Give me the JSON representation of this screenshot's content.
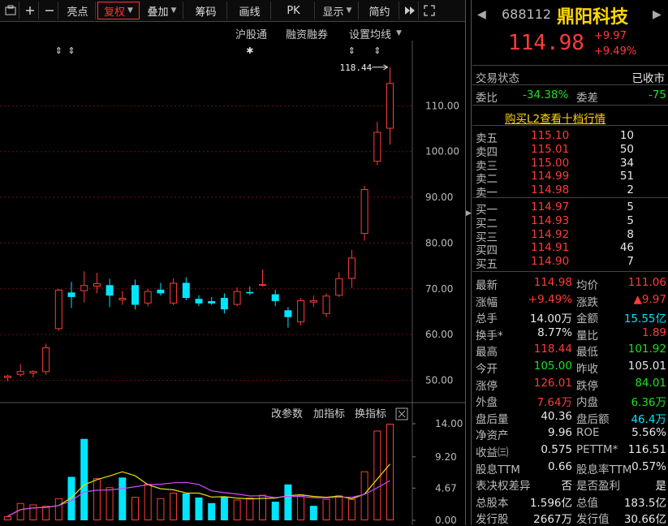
{
  "toolbar": {
    "buttons": [
      "亮点",
      "复权",
      "叠加",
      "筹码",
      "画线",
      "PK",
      "显示",
      "简约"
    ],
    "active": "复权",
    "icons": [
      "screen-icon",
      "plus-icon",
      "minus-icon",
      "fast-forward-icon",
      "expand-icon"
    ]
  },
  "chart_header": {
    "hgt": "沪股通",
    "margin": "融资融券",
    "ma_setting": "设置均线"
  },
  "volume_header": {
    "params": "改参数",
    "add": "加指标",
    "switch": "换指标"
  },
  "markers": {
    "high_label": "118.44"
  },
  "colors": {
    "up": "#ff3b3b",
    "down": "#00e5ff",
    "ma_yellow": "#e8e000",
    "ma_purple": "#d14cff",
    "grid": "#6b1010"
  },
  "chart_data": [
    {
      "type": "candlestick",
      "ylim": [
        46,
        120
      ],
      "price_ticks": [
        "110.00",
        "100.00",
        "90.00",
        "80.00",
        "70.00",
        "60.00",
        "50.00"
      ],
      "tick_values": [
        110,
        100,
        90,
        80,
        70,
        60,
        50
      ],
      "candles": [
        {
          "o": 50.5,
          "h": 51.2,
          "l": 49.8,
          "c": 51.0
        },
        {
          "o": 51.2,
          "h": 53.5,
          "l": 50.8,
          "c": 52.0
        },
        {
          "o": 51.5,
          "h": 52.2,
          "l": 50.6,
          "c": 52.0
        },
        {
          "o": 51.8,
          "h": 58.0,
          "l": 51.2,
          "c": 57.2
        },
        {
          "o": 61.2,
          "h": 70.0,
          "l": 60.8,
          "c": 69.8
        },
        {
          "o": 69.2,
          "h": 71.5,
          "l": 65.8,
          "c": 68.2
        },
        {
          "o": 69.5,
          "h": 73.8,
          "l": 67.0,
          "c": 70.8
        },
        {
          "o": 70.5,
          "h": 73.5,
          "l": 69.0,
          "c": 71.2
        },
        {
          "o": 70.8,
          "h": 72.2,
          "l": 66.0,
          "c": 68.5
        },
        {
          "o": 67.5,
          "h": 69.5,
          "l": 66.5,
          "c": 68.0
        },
        {
          "o": 70.8,
          "h": 72.0,
          "l": 65.5,
          "c": 66.5
        },
        {
          "o": 66.8,
          "h": 70.0,
          "l": 66.2,
          "c": 69.5
        },
        {
          "o": 69.8,
          "h": 71.3,
          "l": 68.5,
          "c": 69.0
        },
        {
          "o": 66.8,
          "h": 72.3,
          "l": 66.4,
          "c": 71.3
        },
        {
          "o": 71.3,
          "h": 72.5,
          "l": 67.5,
          "c": 68.0
        },
        {
          "o": 67.8,
          "h": 68.6,
          "l": 66.2,
          "c": 66.8
        },
        {
          "o": 67.3,
          "h": 68.2,
          "l": 66.5,
          "c": 66.8
        },
        {
          "o": 68.0,
          "h": 69.0,
          "l": 64.6,
          "c": 65.5
        },
        {
          "o": 66.5,
          "h": 70.3,
          "l": 66.2,
          "c": 69.5
        },
        {
          "o": 69.3,
          "h": 70.5,
          "l": 68.6,
          "c": 69.0
        },
        {
          "o": 71.0,
          "h": 74.2,
          "l": 70.5,
          "c": 71.0
        },
        {
          "o": 68.8,
          "h": 69.8,
          "l": 66.2,
          "c": 67.3
        },
        {
          "o": 65.3,
          "h": 66.0,
          "l": 61.5,
          "c": 63.8
        },
        {
          "o": 62.7,
          "h": 68.0,
          "l": 62.0,
          "c": 67.5
        },
        {
          "o": 67.0,
          "h": 68.5,
          "l": 66.0,
          "c": 67.5
        },
        {
          "o": 64.5,
          "h": 69.0,
          "l": 63.8,
          "c": 68.5
        },
        {
          "o": 68.5,
          "h": 73.6,
          "l": 68.2,
          "c": 72.3
        },
        {
          "o": 72.2,
          "h": 78.5,
          "l": 70.2,
          "c": 76.8
        },
        {
          "o": 82.0,
          "h": 92.5,
          "l": 80.5,
          "c": 91.8
        },
        {
          "o": 97.8,
          "h": 106.5,
          "l": 97.0,
          "c": 104.3
        },
        {
          "o": 105.0,
          "h": 118.44,
          "l": 101.5,
          "c": 114.98
        }
      ]
    },
    {
      "type": "bar",
      "ylim": [
        0,
        14.0
      ],
      "vol_ticks": [
        "14.00",
        "9.20",
        "4.67",
        "0.00"
      ],
      "tick_values": [
        14.0,
        9.2,
        4.67,
        0
      ],
      "volumes": [
        0.6,
        2.5,
        2.3,
        2.1,
        3.2,
        6.3,
        11.8,
        6.1,
        4.8,
        6.2,
        3.4,
        5.3,
        3.2,
        4.0,
        3.9,
        3.3,
        2.5,
        3.4,
        3.0,
        3.3,
        3.7,
        2.7,
        5.2,
        3.6,
        2.1,
        3.1,
        3.6,
        3.1,
        7.1,
        13.0,
        14.0
      ],
      "up": [
        true,
        true,
        true,
        true,
        true,
        false,
        false,
        true,
        true,
        false,
        true,
        true,
        true,
        true,
        false,
        false,
        false,
        false,
        true,
        true,
        true,
        false,
        false,
        true,
        false,
        true,
        true,
        true,
        true,
        true,
        true
      ]
    }
  ],
  "quote": {
    "code": "688112",
    "name": "鼎阳科技",
    "price": "114.98",
    "change": "+9.97",
    "change_pct": "+9.49%"
  },
  "status": {
    "label": "交易状态",
    "value": "已收市"
  },
  "weibi": {
    "label1": "委比",
    "v1": "-34.38%",
    "label2": "委差",
    "v2": "-75"
  },
  "l2_link": "购买L2查看十档行情",
  "sells": [
    {
      "label": "卖五",
      "price": "115.10",
      "vol": "10"
    },
    {
      "label": "卖四",
      "price": "115.01",
      "vol": "50"
    },
    {
      "label": "卖三",
      "price": "115.00",
      "vol": "34"
    },
    {
      "label": "卖二",
      "price": "114.99",
      "vol": "51"
    },
    {
      "label": "卖一",
      "price": "114.98",
      "vol": "2"
    }
  ],
  "buys": [
    {
      "label": "买一",
      "price": "114.97",
      "vol": "5"
    },
    {
      "label": "买二",
      "price": "114.93",
      "vol": "5"
    },
    {
      "label": "买三",
      "price": "114.92",
      "vol": "8"
    },
    {
      "label": "买四",
      "price": "114.91",
      "vol": "46"
    },
    {
      "label": "买五",
      "price": "114.90",
      "vol": "7"
    }
  ],
  "stats": [
    {
      "l1": "最新",
      "v1": "114.98",
      "c1": "red",
      "l2": "均价",
      "v2": "111.06",
      "c2": "red"
    },
    {
      "l1": "涨幅",
      "v1": "+9.49%",
      "c1": "red",
      "l2": "涨跌",
      "v2": "▲9.97",
      "c2": "red"
    },
    {
      "l1": "总手",
      "v1": "14.00万",
      "c1": "white",
      "l2": "金额",
      "v2": "15.55亿",
      "c2": "cyan"
    },
    {
      "l1": "换手*",
      "v1": "8.77%",
      "c1": "white",
      "l2": "量比",
      "v2": "1.89",
      "c2": "red"
    },
    {
      "l1": "最高",
      "v1": "118.44",
      "c1": "red",
      "l2": "最低",
      "v2": "101.92",
      "c2": "green"
    },
    {
      "l1": "今开",
      "v1": "105.00",
      "c1": "green",
      "l2": "昨收",
      "v2": "105.01",
      "c2": "white"
    },
    {
      "l1": "涨停",
      "v1": "126.01",
      "c1": "red",
      "l2": "跌停",
      "v2": "84.01",
      "c2": "green"
    },
    {
      "l1": "外盘",
      "v1": "7.64万",
      "c1": "red",
      "l2": "内盘",
      "v2": "6.36万",
      "c2": "green"
    },
    {
      "l1": "盘后量",
      "v1": "40.36",
      "c1": "white",
      "l2": "盘后额",
      "v2": "46.4万",
      "c2": "cyan"
    },
    {
      "l1": "净资产",
      "v1": "9.96",
      "c1": "white",
      "l2": "ROE",
      "v2": "5.56%",
      "c2": "white"
    },
    {
      "l1": "收益㈢",
      "v1": "0.575",
      "c1": "white",
      "l2": "PETTM*",
      "v2": "116.51",
      "c2": "white"
    },
    {
      "l1": "股息TTM",
      "v1": "0.66",
      "c1": "white",
      "l2": "股息率TTM",
      "v2": "0.57%",
      "c2": "white"
    },
    {
      "l1": "表决权差异",
      "v1": "否",
      "c1": "white",
      "l2": "是否盈利",
      "v2": "是",
      "c2": "white"
    },
    {
      "l1": "总股本",
      "v1": "1.596亿",
      "c1": "white",
      "l2": "总值",
      "v2": "183.5亿",
      "c2": "white"
    },
    {
      "l1": "发行股",
      "v1": "2667万",
      "c1": "white",
      "l2": "发行值",
      "v2": "30.66亿",
      "c2": "white"
    }
  ]
}
